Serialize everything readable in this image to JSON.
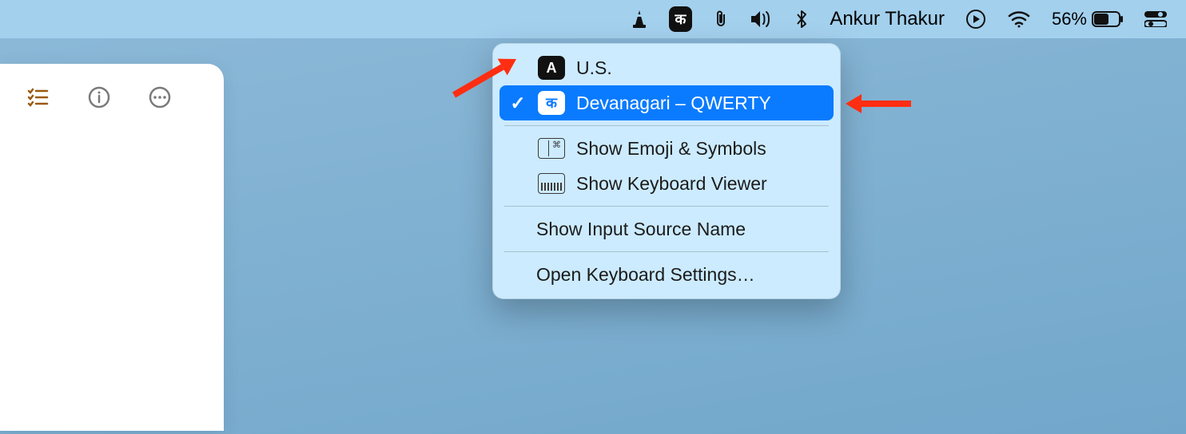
{
  "menubar": {
    "username": "Ankur Thakur",
    "battery_percent": "56%",
    "input_icon_glyph": "क"
  },
  "dropdown": {
    "items": [
      {
        "label": "U.S.",
        "badge": "A",
        "selected": false
      },
      {
        "label": "Devanagari – QWERTY",
        "badge": "क",
        "selected": true
      }
    ],
    "options": {
      "emoji": "Show Emoji & Symbols",
      "viewer": "Show Keyboard Viewer",
      "show_name": "Show Input Source Name",
      "open_settings": "Open Keyboard Settings…"
    }
  }
}
